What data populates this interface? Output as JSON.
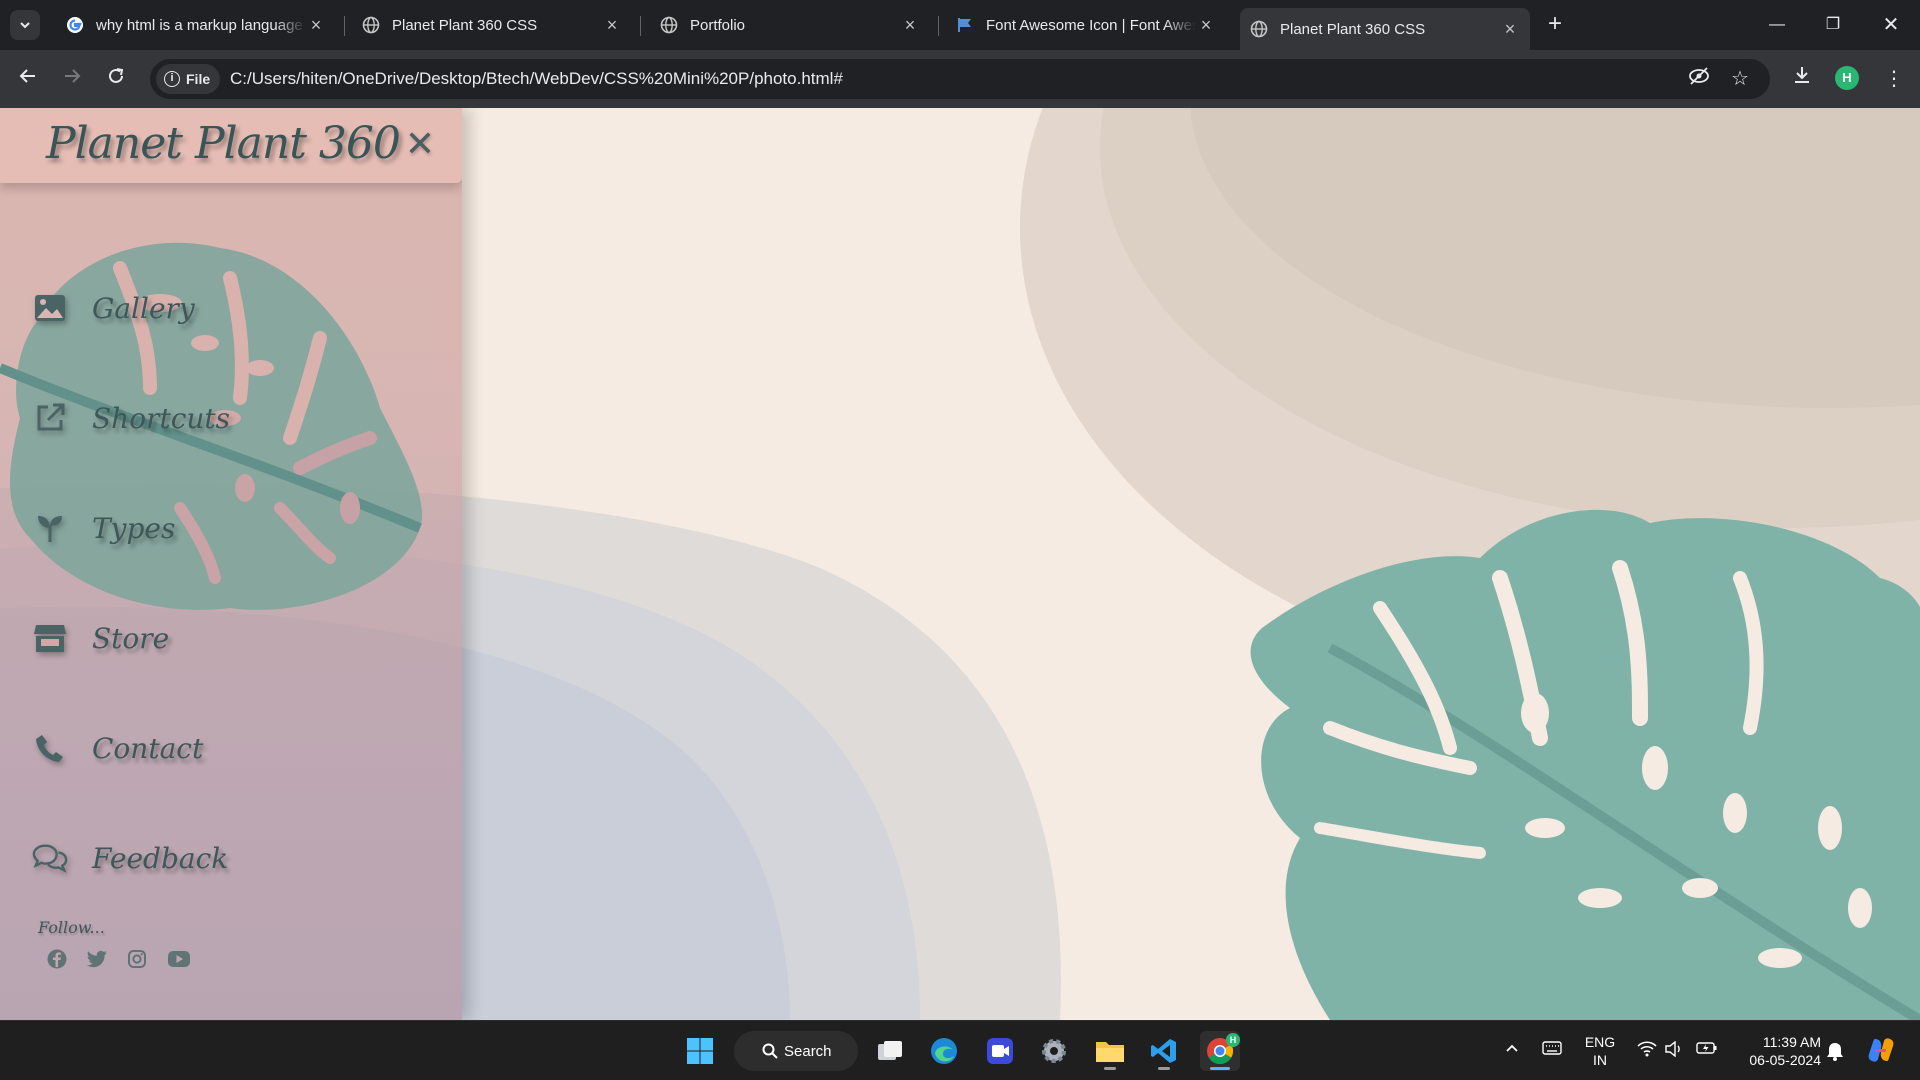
{
  "browser": {
    "tabs": [
      {
        "title": "why html is a markup language",
        "favicon": "google-g-icon",
        "active": false
      },
      {
        "title": "Planet Plant 360 CSS",
        "favicon": "globe-icon",
        "active": false
      },
      {
        "title": "Portfolio",
        "favicon": "globe-icon",
        "active": false
      },
      {
        "title": "Font Awesome Icon | Font Awesome",
        "favicon": "flag-icon",
        "active": false
      },
      {
        "title": "Planet Plant 360 CSS",
        "favicon": "globe-icon",
        "active": true
      }
    ],
    "address": {
      "chip_label": "File",
      "url": "C:/Users/hiten/OneDrive/Desktop/Btech/WebDev/CSS%20Mini%20P/photo.html#"
    },
    "profile_initial": "H"
  },
  "page": {
    "logo": "Planet Plant 360",
    "close_symbol": "✕",
    "menu": [
      {
        "label": "Gallery",
        "icon": "image-icon"
      },
      {
        "label": "Shortcuts",
        "icon": "external-link-icon"
      },
      {
        "label": "Types",
        "icon": "seedling-icon"
      },
      {
        "label": "Store",
        "icon": "store-icon"
      },
      {
        "label": "Contact",
        "icon": "phone-icon"
      },
      {
        "label": "Feedback",
        "icon": "comments-icon"
      }
    ],
    "follow_label": "Follow...",
    "social": [
      "facebook-icon",
      "twitter-icon",
      "instagram-icon",
      "youtube-icon"
    ],
    "colors": {
      "background": "#f5ebe2",
      "leaf": "#7fb3a8",
      "text": "#3e5759"
    }
  },
  "taskbar": {
    "search_label": "Search",
    "language": "ENG",
    "region": "IN",
    "time": "11:39 AM",
    "date": "06-05-2024",
    "chrome_badge": "H"
  }
}
